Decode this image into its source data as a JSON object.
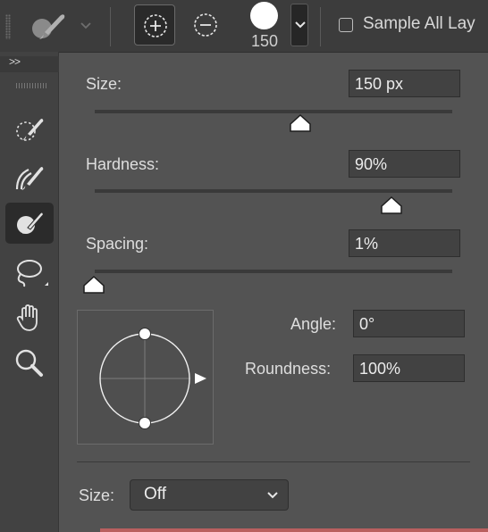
{
  "options_bar": {
    "tool_preset_icon": "quick-selection-brush-icon",
    "add_to_selection_icon": "add-to-selection-icon",
    "subtract_from_selection_icon": "subtract-from-selection-icon",
    "brush_size_value": "150",
    "sample_all_layers_label": "Sample All Lay",
    "sample_all_layers_checked": false
  },
  "toolbar": {
    "collapse_label": ">>",
    "tools": [
      {
        "name": "quick-selection-dotted-icon",
        "active": false
      },
      {
        "name": "smart-brush-icon",
        "active": false
      },
      {
        "name": "quick-selection-icon",
        "active": true
      },
      {
        "name": "lasso-icon",
        "active": false
      },
      {
        "name": "hand-icon",
        "active": false
      },
      {
        "name": "zoom-icon",
        "active": false
      }
    ]
  },
  "brush_panel": {
    "size": {
      "label": "Size:",
      "value": "150 px",
      "slider_fraction": 0.625
    },
    "hardness": {
      "label": "Hardness:",
      "value": "90%",
      "slider_fraction": 0.9
    },
    "spacing": {
      "label": "Spacing:",
      "value": "1%",
      "slider_fraction": 0.0
    },
    "angle": {
      "label": "Angle:",
      "value": "0°"
    },
    "roundness": {
      "label": "Roundness:",
      "value": "100%"
    },
    "size_control": {
      "label": "Size:",
      "value": "Off"
    }
  }
}
